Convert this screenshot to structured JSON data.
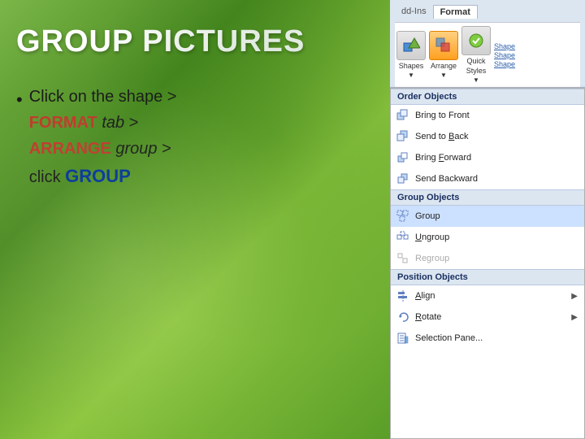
{
  "slide": {
    "title": "GROUP PICTURES",
    "bullet": {
      "prefix": "Click on the shape > ",
      "line2_start": "FORMAT ",
      "line2_tab": "tab",
      "line2_end": " > ",
      "line3_start": "ARRANGE ",
      "line3_group": "group",
      "line3_end": " > ",
      "line4_start": "click ",
      "line4_group": "GROUP"
    }
  },
  "ribbon": {
    "tabs": [
      "dd-Ins",
      "Format"
    ],
    "active_tab": "Format",
    "buttons": {
      "shapes_label": "Shapes",
      "arrange_label": "Arrange",
      "quick_label": "Quick\nStyles"
    },
    "shapes_side": [
      "Shape",
      "Shape",
      "Shape"
    ]
  },
  "menu": {
    "sections": [
      {
        "header": "Order Objects",
        "items": [
          {
            "label": "Bring to Front",
            "disabled": false,
            "has_arrow": false
          },
          {
            "label": "Send to Back",
            "disabled": false,
            "has_arrow": false
          },
          {
            "label": "Bring Forward",
            "disabled": false,
            "has_arrow": false
          },
          {
            "label": "Send Backward",
            "disabled": false,
            "has_arrow": false
          }
        ]
      },
      {
        "header": "Group Objects",
        "items": [
          {
            "label": "Group",
            "disabled": false,
            "has_arrow": false,
            "highlighted": true
          },
          {
            "label": "Ungroup",
            "disabled": false,
            "has_arrow": false
          },
          {
            "label": "Regroup",
            "disabled": true,
            "has_arrow": false
          }
        ]
      },
      {
        "header": "Position Objects",
        "items": [
          {
            "label": "Align",
            "disabled": false,
            "has_arrow": true
          },
          {
            "label": "Rotate",
            "disabled": false,
            "has_arrow": true
          },
          {
            "label": "Selection Pane...",
            "disabled": false,
            "has_arrow": false
          }
        ]
      }
    ]
  }
}
